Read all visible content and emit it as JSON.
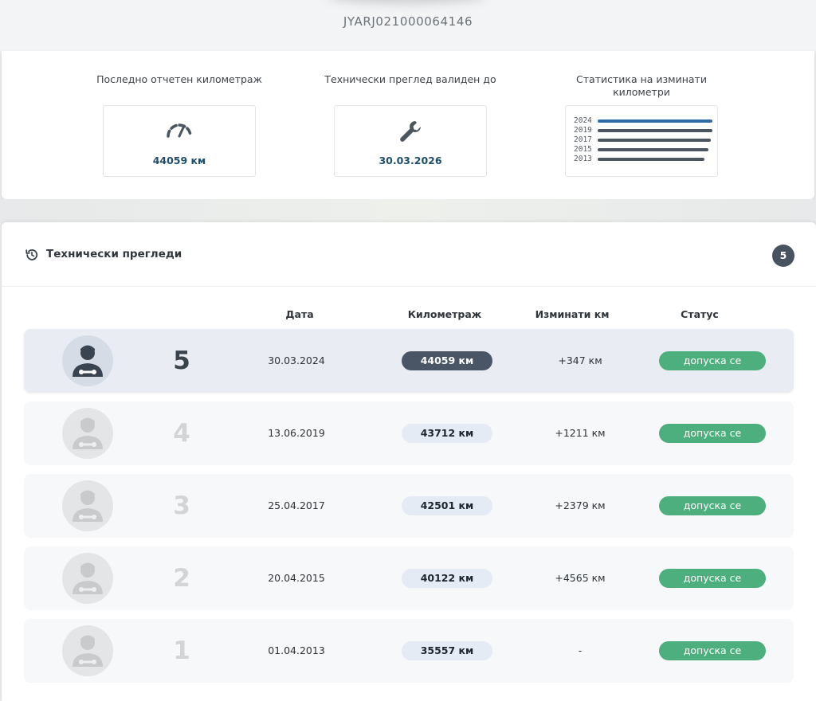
{
  "vehicle": {
    "vin": "JYARJ021000064146"
  },
  "stats": {
    "mileage": {
      "title": "Последно отчетен километраж",
      "value": "44059 км",
      "icon": "speedometer-icon"
    },
    "inspection": {
      "title": "Технически преглед валиден до",
      "value": "30.03.2026",
      "icon": "wrench-icon"
    },
    "mileage_stats": {
      "title": "Статистика на изминати километри",
      "chart_data": {
        "type": "bar",
        "orientation": "horizontal",
        "categories": [
          "2024",
          "2019",
          "2017",
          "2015",
          "2013"
        ],
        "values": [
          44059,
          43712,
          42501,
          40122,
          35557
        ],
        "highlight_color": "#2e6da4",
        "bar_color": "#4a5560"
      }
    }
  },
  "reviews": {
    "title": "Технически прегледи",
    "count": "5",
    "columns": {
      "date": "Дата",
      "mileage": "Километраж",
      "diff": "Изминати км",
      "status": "Статус"
    },
    "rows": [
      {
        "num": "5",
        "date": "30.03.2024",
        "km": "44059 км",
        "diff": "+347 км",
        "status": "допуска се"
      },
      {
        "num": "4",
        "date": "13.06.2019",
        "km": "43712 км",
        "diff": "+1211 км",
        "status": "допуска се"
      },
      {
        "num": "3",
        "date": "25.04.2017",
        "km": "42501 км",
        "diff": "+2379 км",
        "status": "допуска се"
      },
      {
        "num": "2",
        "date": "20.04.2015",
        "km": "40122 км",
        "diff": "+4565 км",
        "status": "допуска се"
      },
      {
        "num": "1",
        "date": "01.04.2013",
        "km": "35557 км",
        "diff": "-",
        "status": "допуска се"
      }
    ]
  },
  "colors": {
    "accent": "#1f4e6b",
    "status_ok": "#4caf7d",
    "active_pill": "#4a5666",
    "badge": "#48535f"
  }
}
